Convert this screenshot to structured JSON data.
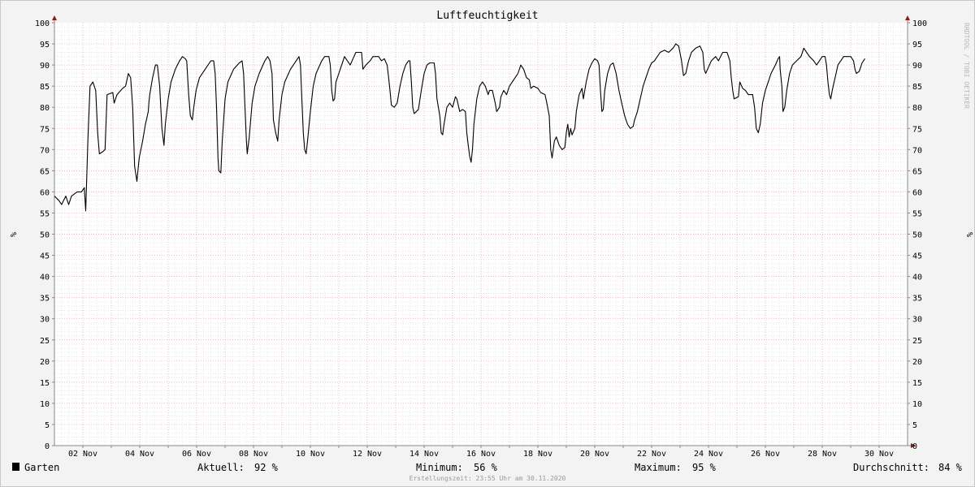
{
  "chart_data": {
    "type": "line",
    "title": "Luftfeuchtigkeit",
    "ylabel_left": "%",
    "ylabel_right": "%",
    "ylim": [
      0,
      100
    ],
    "yticks": [
      0,
      5,
      10,
      15,
      20,
      25,
      30,
      35,
      40,
      45,
      50,
      55,
      60,
      65,
      70,
      75,
      80,
      85,
      90,
      95,
      100
    ],
    "xlim": [
      0,
      30
    ],
    "xtick_positions": [
      1,
      3,
      5,
      7,
      9,
      11,
      13,
      15,
      17,
      19,
      21,
      23,
      25,
      27,
      29
    ],
    "xtick_labels": [
      "02 Nov",
      "04 Nov",
      "06 Nov",
      "08 Nov",
      "10 Nov",
      "12 Nov",
      "14 Nov",
      "16 Nov",
      "18 Nov",
      "20 Nov",
      "22 Nov",
      "24 Nov",
      "26 Nov",
      "28 Nov",
      "30 Nov"
    ],
    "grid": true,
    "series": [
      {
        "name": "Garten",
        "color": "#000000",
        "points": [
          [
            0.0,
            59
          ],
          [
            0.15,
            58
          ],
          [
            0.25,
            57
          ],
          [
            0.4,
            59
          ],
          [
            0.5,
            57
          ],
          [
            0.6,
            59
          ],
          [
            0.8,
            60
          ],
          [
            0.95,
            60
          ],
          [
            1.05,
            61
          ],
          [
            1.1,
            55.5
          ],
          [
            1.18,
            73
          ],
          [
            1.25,
            85
          ],
          [
            1.35,
            86
          ],
          [
            1.45,
            84
          ],
          [
            1.52,
            74
          ],
          [
            1.58,
            69
          ],
          [
            1.7,
            69.5
          ],
          [
            1.78,
            70
          ],
          [
            1.85,
            83
          ],
          [
            2.05,
            83.5
          ],
          [
            2.1,
            81
          ],
          [
            2.2,
            83
          ],
          [
            2.4,
            84.5
          ],
          [
            2.5,
            85
          ],
          [
            2.6,
            88
          ],
          [
            2.68,
            87
          ],
          [
            2.75,
            80
          ],
          [
            2.82,
            66
          ],
          [
            2.9,
            62.5
          ],
          [
            2.98,
            68
          ],
          [
            3.1,
            72
          ],
          [
            3.2,
            76
          ],
          [
            3.3,
            79
          ],
          [
            3.32,
            81
          ],
          [
            3.35,
            83
          ],
          [
            3.45,
            87
          ],
          [
            3.55,
            90
          ],
          [
            3.62,
            90
          ],
          [
            3.7,
            85
          ],
          [
            3.78,
            75
          ],
          [
            3.85,
            71
          ],
          [
            3.9,
            76
          ],
          [
            4.0,
            82
          ],
          [
            4.1,
            86
          ],
          [
            4.25,
            89
          ],
          [
            4.4,
            91
          ],
          [
            4.5,
            92
          ],
          [
            4.6,
            91.5
          ],
          [
            4.65,
            91
          ],
          [
            4.72,
            83
          ],
          [
            4.78,
            78
          ],
          [
            4.85,
            77
          ],
          [
            4.9,
            80
          ],
          [
            4.98,
            84
          ],
          [
            5.1,
            87
          ],
          [
            5.3,
            89
          ],
          [
            5.5,
            91
          ],
          [
            5.6,
            91
          ],
          [
            5.65,
            88
          ],
          [
            5.7,
            80
          ],
          [
            5.75,
            68
          ],
          [
            5.78,
            65
          ],
          [
            5.85,
            64.5
          ],
          [
            5.9,
            72
          ],
          [
            6.0,
            82
          ],
          [
            6.1,
            86
          ],
          [
            6.3,
            89
          ],
          [
            6.5,
            90.5
          ],
          [
            6.6,
            91
          ],
          [
            6.65,
            88
          ],
          [
            6.7,
            80
          ],
          [
            6.75,
            72
          ],
          [
            6.78,
            69
          ],
          [
            6.85,
            73
          ],
          [
            6.95,
            81
          ],
          [
            7.05,
            85
          ],
          [
            7.2,
            88
          ],
          [
            7.4,
            91
          ],
          [
            7.5,
            92
          ],
          [
            7.58,
            91
          ],
          [
            7.65,
            88
          ],
          [
            7.7,
            77
          ],
          [
            7.78,
            74
          ],
          [
            7.85,
            72
          ],
          [
            7.9,
            77
          ],
          [
            8.0,
            83
          ],
          [
            8.1,
            86
          ],
          [
            8.3,
            89
          ],
          [
            8.5,
            91
          ],
          [
            8.6,
            92
          ],
          [
            8.65,
            90
          ],
          [
            8.7,
            82
          ],
          [
            8.75,
            74
          ],
          [
            8.8,
            70
          ],
          [
            8.85,
            69
          ],
          [
            8.9,
            72
          ],
          [
            9.0,
            79
          ],
          [
            9.1,
            85
          ],
          [
            9.2,
            88
          ],
          [
            9.4,
            91
          ],
          [
            9.5,
            92
          ],
          [
            9.65,
            92
          ],
          [
            9.7,
            90
          ],
          [
            9.75,
            84
          ],
          [
            9.8,
            81.5
          ],
          [
            9.85,
            82
          ],
          [
            9.9,
            86
          ],
          [
            10.0,
            88
          ],
          [
            10.1,
            90
          ],
          [
            10.2,
            92
          ],
          [
            10.3,
            91
          ],
          [
            10.4,
            90
          ],
          [
            10.5,
            91.5
          ],
          [
            10.6,
            93
          ],
          [
            10.8,
            93
          ],
          [
            10.85,
            89
          ],
          [
            10.95,
            90
          ],
          [
            11.1,
            91
          ],
          [
            11.2,
            92
          ],
          [
            11.4,
            92
          ],
          [
            11.5,
            91
          ],
          [
            11.6,
            91.5
          ],
          [
            11.7,
            90
          ],
          [
            11.75,
            87
          ],
          [
            11.8,
            84
          ],
          [
            11.85,
            80.5
          ],
          [
            11.95,
            80
          ],
          [
            12.05,
            81
          ],
          [
            12.15,
            85
          ],
          [
            12.25,
            88
          ],
          [
            12.35,
            90
          ],
          [
            12.45,
            91
          ],
          [
            12.5,
            91
          ],
          [
            12.55,
            86
          ],
          [
            12.6,
            80
          ],
          [
            12.65,
            78.5
          ],
          [
            12.8,
            79.5
          ],
          [
            12.9,
            84
          ],
          [
            13.0,
            88
          ],
          [
            13.1,
            90
          ],
          [
            13.2,
            90.5
          ],
          [
            13.35,
            90.5
          ],
          [
            13.4,
            88
          ],
          [
            13.45,
            82
          ],
          [
            13.55,
            78
          ],
          [
            13.6,
            74
          ],
          [
            13.65,
            73.5
          ],
          [
            13.7,
            76
          ],
          [
            13.8,
            80
          ],
          [
            13.9,
            81
          ],
          [
            14.0,
            80
          ],
          [
            14.1,
            82.5
          ],
          [
            14.15,
            82
          ],
          [
            14.25,
            79
          ],
          [
            14.35,
            79.5
          ],
          [
            14.45,
            79
          ],
          [
            14.5,
            74
          ],
          [
            14.55,
            71
          ],
          [
            14.6,
            68.5
          ],
          [
            14.65,
            67
          ],
          [
            14.7,
            70
          ],
          [
            14.75,
            76
          ],
          [
            14.85,
            82
          ],
          [
            14.95,
            85
          ],
          [
            15.05,
            86
          ],
          [
            15.15,
            85
          ],
          [
            15.25,
            83
          ],
          [
            15.3,
            84
          ],
          [
            15.4,
            84
          ],
          [
            15.5,
            81
          ],
          [
            15.55,
            79
          ],
          [
            15.65,
            80
          ],
          [
            15.7,
            82.5
          ],
          [
            15.8,
            84
          ],
          [
            15.9,
            83
          ],
          [
            16.0,
            85
          ],
          [
            16.1,
            86
          ],
          [
            16.2,
            87
          ],
          [
            16.3,
            88
          ],
          [
            16.4,
            90
          ],
          [
            16.5,
            89
          ],
          [
            16.6,
            87
          ],
          [
            16.7,
            86.5
          ],
          [
            16.75,
            84.5
          ],
          [
            16.85,
            85
          ],
          [
            17.0,
            84.5
          ],
          [
            17.1,
            83.5
          ],
          [
            17.25,
            83
          ],
          [
            17.3,
            81.5
          ],
          [
            17.4,
            78
          ],
          [
            17.45,
            70
          ],
          [
            17.5,
            68
          ],
          [
            17.58,
            72
          ],
          [
            17.65,
            73
          ],
          [
            17.75,
            71
          ],
          [
            17.85,
            70
          ],
          [
            17.95,
            70.5
          ],
          [
            18.0,
            74
          ],
          [
            18.05,
            76
          ],
          [
            18.1,
            73
          ],
          [
            18.15,
            75
          ],
          [
            18.2,
            73.5
          ],
          [
            18.3,
            75
          ],
          [
            18.35,
            79
          ],
          [
            18.45,
            83
          ],
          [
            18.55,
            84.5
          ],
          [
            18.6,
            82
          ],
          [
            18.7,
            86
          ],
          [
            18.8,
            89
          ],
          [
            18.9,
            90.5
          ],
          [
            19.0,
            91.5
          ],
          [
            19.1,
            91
          ],
          [
            19.15,
            90
          ],
          [
            19.2,
            84
          ],
          [
            19.25,
            79
          ],
          [
            19.3,
            79.5
          ],
          [
            19.35,
            84
          ],
          [
            19.45,
            88
          ],
          [
            19.55,
            90
          ],
          [
            19.65,
            90.5
          ],
          [
            19.75,
            88
          ],
          [
            19.85,
            84
          ],
          [
            19.95,
            81
          ],
          [
            20.05,
            78
          ],
          [
            20.15,
            76
          ],
          [
            20.25,
            75
          ],
          [
            20.35,
            75.5
          ],
          [
            20.4,
            77
          ],
          [
            20.5,
            79
          ],
          [
            20.6,
            82
          ],
          [
            20.7,
            85
          ],
          [
            20.8,
            87
          ],
          [
            20.9,
            89
          ],
          [
            21.0,
            90.5
          ],
          [
            21.1,
            91
          ],
          [
            21.2,
            92
          ],
          [
            21.3,
            93
          ],
          [
            21.45,
            93.5
          ],
          [
            21.6,
            93
          ],
          [
            21.75,
            94
          ],
          [
            21.85,
            95
          ],
          [
            21.95,
            94.5
          ],
          [
            22.05,
            91
          ],
          [
            22.12,
            87.5
          ],
          [
            22.2,
            88
          ],
          [
            22.3,
            91
          ],
          [
            22.4,
            93
          ],
          [
            22.55,
            94
          ],
          [
            22.7,
            94.5
          ],
          [
            22.8,
            93
          ],
          [
            22.85,
            89
          ],
          [
            22.9,
            88
          ],
          [
            23.0,
            89.5
          ],
          [
            23.1,
            91
          ],
          [
            23.25,
            92
          ],
          [
            23.35,
            91
          ],
          [
            23.5,
            93
          ],
          [
            23.65,
            93
          ],
          [
            23.75,
            91
          ],
          [
            23.8,
            87
          ],
          [
            23.85,
            84
          ],
          [
            23.9,
            82
          ],
          [
            24.05,
            82.5
          ],
          [
            24.1,
            86
          ],
          [
            24.2,
            84.5
          ],
          [
            24.3,
            84
          ],
          [
            24.4,
            83
          ],
          [
            24.55,
            83
          ],
          [
            24.62,
            80
          ],
          [
            24.68,
            75
          ],
          [
            24.75,
            74
          ],
          [
            24.82,
            76
          ],
          [
            24.9,
            81
          ],
          [
            25.0,
            84
          ],
          [
            25.1,
            86
          ],
          [
            25.2,
            88
          ],
          [
            25.35,
            90
          ],
          [
            25.45,
            91.5
          ],
          [
            25.5,
            92
          ],
          [
            25.52,
            89
          ],
          [
            25.58,
            85
          ],
          [
            25.62,
            79
          ],
          [
            25.68,
            80
          ],
          [
            25.75,
            84
          ],
          [
            25.85,
            88
          ],
          [
            25.95,
            90
          ],
          [
            26.1,
            91
          ],
          [
            26.25,
            92
          ],
          [
            26.35,
            94
          ],
          [
            26.45,
            93
          ],
          [
            26.55,
            92
          ],
          [
            26.7,
            91
          ],
          [
            26.8,
            90
          ],
          [
            26.9,
            91
          ],
          [
            27.0,
            92
          ],
          [
            27.1,
            92
          ],
          [
            27.15,
            90
          ],
          [
            27.2,
            86
          ],
          [
            27.25,
            83
          ],
          [
            27.3,
            82
          ],
          [
            27.35,
            84
          ],
          [
            27.45,
            87
          ],
          [
            27.55,
            90
          ],
          [
            27.65,
            91
          ],
          [
            27.75,
            92
          ],
          [
            28.0,
            92
          ],
          [
            28.1,
            91
          ],
          [
            28.15,
            89
          ],
          [
            28.2,
            88
          ],
          [
            28.3,
            88.5
          ],
          [
            28.4,
            90.5
          ],
          [
            28.5,
            91.5
          ]
        ]
      }
    ],
    "legend": [
      {
        "label": "Garten",
        "color": "#000000"
      }
    ],
    "stats": {
      "current_label": "Aktuell:",
      "current_value": "92 %",
      "min_label": "Minimum:",
      "min_value": "56 %",
      "max_label": "Maximum:",
      "max_value": "95 %",
      "avg_label": "Durchschnitt:",
      "avg_value": "84 %"
    }
  },
  "footer": "Erstellungszeit: 23:55 Uhr am 30.11.2020",
  "watermark": "RRDTOOL / TOBI OETIKER"
}
